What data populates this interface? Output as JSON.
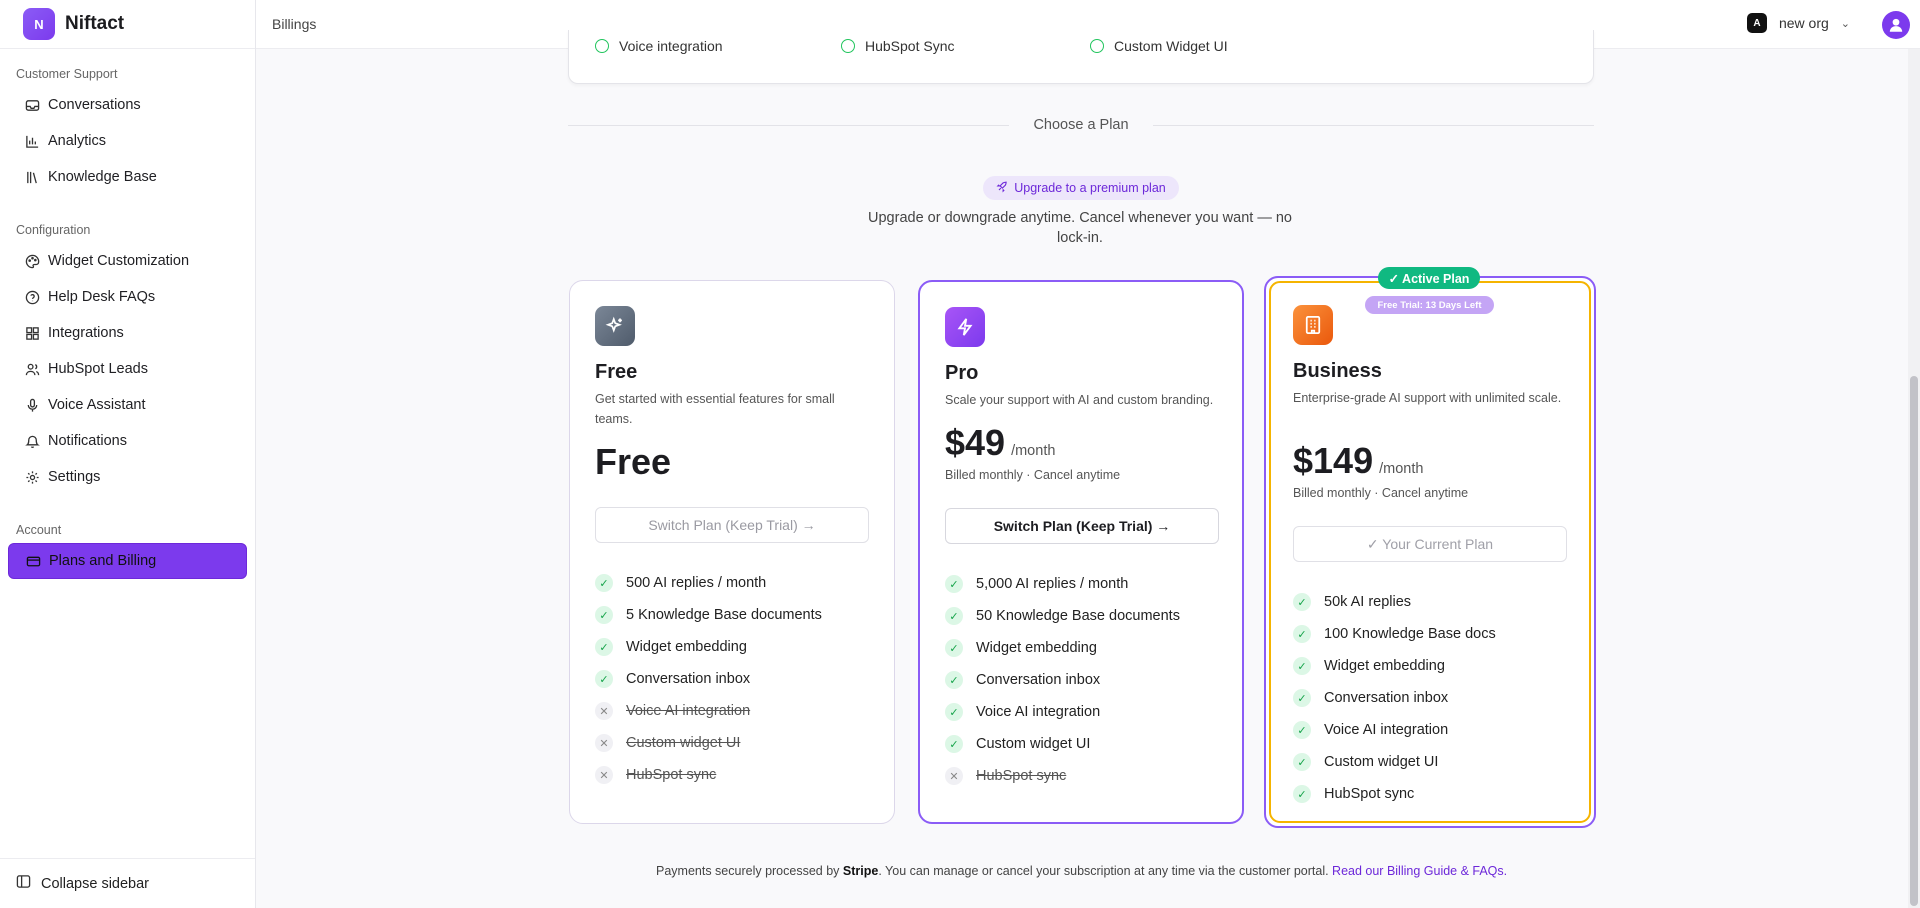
{
  "brand": {
    "logo_text": "N",
    "name": "Niftact"
  },
  "header": {
    "breadcrumb": "Billings",
    "org_badge": "A",
    "org_name": "new org",
    "chevron": "⌄"
  },
  "sidebar": {
    "sections": [
      {
        "title": "Customer Support",
        "items": [
          "Conversations",
          "Analytics",
          "Knowledge Base"
        ]
      },
      {
        "title": "Configuration",
        "items": [
          "Widget Customization",
          "Help Desk FAQs",
          "Integrations",
          "HubSpot Leads",
          "Voice Assistant",
          "Notifications",
          "Settings"
        ]
      },
      {
        "title": "Account",
        "items": [
          "Plans and Billing"
        ]
      }
    ],
    "collapse_label": "Collapse sidebar",
    "active_color": "#7c3aed"
  },
  "previous_card": {
    "features": [
      "Voice integration",
      "HubSpot Sync",
      "Custom Widget UI"
    ]
  },
  "choose": {
    "divider_label": "Choose a Plan",
    "pill_label": "Upgrade to a premium plan",
    "subtitle": "Upgrade or downgrade anytime. Cancel whenever you want — no lock-in."
  },
  "plans": {
    "free": {
      "name": "Free",
      "description": "Get started with essential features for small teams.",
      "price": "Free",
      "button": "Switch Plan (Keep Trial) →",
      "features": [
        {
          "label": "500 AI replies / month",
          "included": true
        },
        {
          "label": "5 Knowledge Base documents",
          "included": true
        },
        {
          "label": "Widget embedding",
          "included": true
        },
        {
          "label": "Conversation inbox",
          "included": true
        },
        {
          "label": "Voice AI integration",
          "included": false
        },
        {
          "label": "Custom widget UI",
          "included": false
        },
        {
          "label": "HubSpot sync",
          "included": false
        }
      ]
    },
    "pro": {
      "name": "Pro",
      "description": "Scale your support with AI and custom branding.",
      "price": "$49",
      "period": "/month",
      "billed": "Billed monthly · Cancel anytime",
      "button": "Switch Plan (Keep Trial) →",
      "features": [
        {
          "label": "5,000 AI replies / month",
          "included": true
        },
        {
          "label": "50 Knowledge Base documents",
          "included": true
        },
        {
          "label": "Widget embedding",
          "included": true
        },
        {
          "label": "Conversation inbox",
          "included": true
        },
        {
          "label": "Voice AI integration",
          "included": true
        },
        {
          "label": "Custom widget UI",
          "included": true
        },
        {
          "label": "HubSpot sync",
          "included": false
        }
      ]
    },
    "business": {
      "name": "Business",
      "description": "Enterprise-grade AI support with unlimited scale.",
      "price": "$149",
      "period": "/month",
      "billed": "Billed monthly · Cancel anytime",
      "button": "✓ Your Current Plan",
      "badge_active": "✓ Active Plan",
      "badge_trial": "Free Trial: 13 Days Left",
      "features": [
        {
          "label": "50k AI replies",
          "included": true
        },
        {
          "label": "100 Knowledge Base docs",
          "included": true
        },
        {
          "label": "Widget embedding",
          "included": true
        },
        {
          "label": "Conversation inbox",
          "included": true
        },
        {
          "label": "Voice AI integration",
          "included": true
        },
        {
          "label": "Custom widget UI",
          "included": true
        },
        {
          "label": "HubSpot sync",
          "included": true
        }
      ]
    }
  },
  "footer": {
    "prefix": "Payments securely processed by ",
    "provider": "Stripe",
    "middle": ". You can manage or cancel your subscription at any time via the customer portal. ",
    "link": "Read our Billing Guide & FAQs."
  },
  "icons": {
    "check": "✓",
    "cross": "✕"
  },
  "colors": {
    "accent": "#7c3aed",
    "success": "#10b981",
    "business_border": "#f5b400"
  }
}
